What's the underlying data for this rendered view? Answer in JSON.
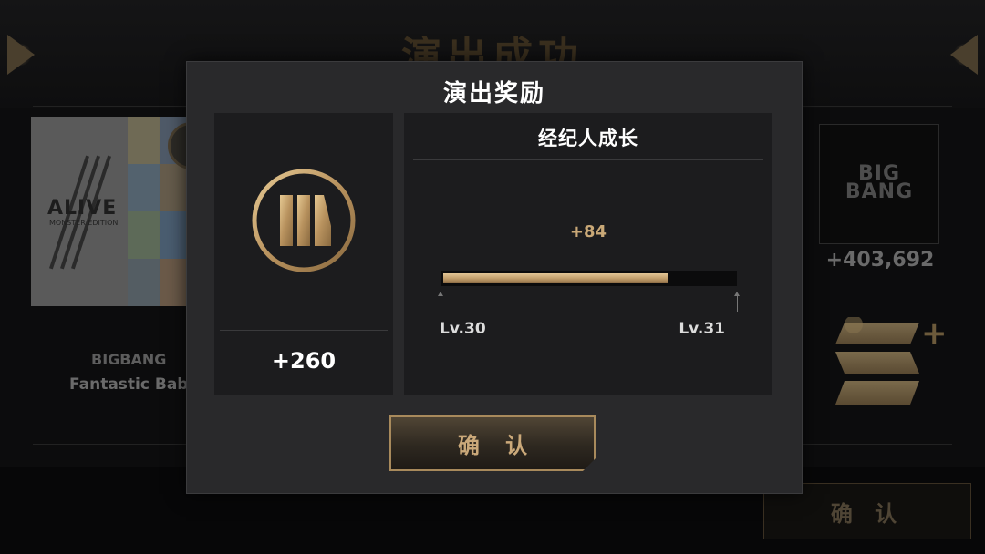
{
  "background": {
    "title": "演出成功",
    "album": {
      "title": "ALIVE",
      "subtitle": "MONSTER EDITION"
    },
    "artist": "BIGBANG",
    "song": "Fantastic Baby",
    "logo_text_line1": "BIG",
    "logo_text_line2": "BANG",
    "score": "+403,692",
    "rank_plus": "+",
    "confirm_label": "确 认"
  },
  "modal": {
    "title": "演出奖励",
    "reward": {
      "value": "+260",
      "icon": "currency-coin-icon"
    },
    "growth": {
      "title": "经纪人成长",
      "xp_gain": "+84",
      "progress_fraction": 0.77,
      "level_from": "Lv.30",
      "level_to": "Lv.31"
    },
    "confirm_label": "确 认"
  },
  "colors": {
    "gold_accent": "#c9a877",
    "modal_bg": "#29292b",
    "panel_bg": "#1c1c1e",
    "button_border": "#a88a5c"
  }
}
